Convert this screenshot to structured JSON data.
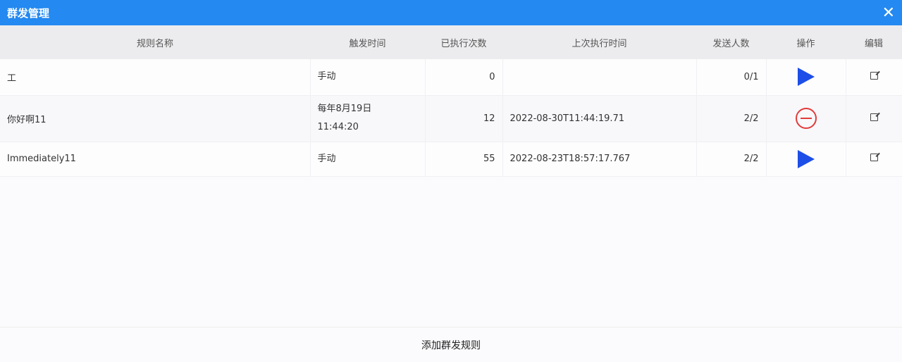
{
  "window": {
    "title": "群发管理"
  },
  "table": {
    "headers": [
      "规则名称",
      "触发时间",
      "已执行次数",
      "上次执行时间",
      "发送人数",
      "操作",
      "编辑"
    ],
    "rows": [
      {
        "name": "工",
        "trigger": "手动",
        "trigger2": "",
        "count": "0",
        "last": "",
        "senders": "0/1",
        "action": "play-icon"
      },
      {
        "name": "你好啊11",
        "trigger": "每年8月19日",
        "trigger2": "11:44:20",
        "count": "12",
        "last": "2022-08-30T11:44:19.71",
        "senders": "2/2",
        "action": "stop-icon"
      },
      {
        "name": "Immediately11",
        "trigger": "手动",
        "trigger2": "",
        "count": "55",
        "last": "2022-08-23T18:57:17.767",
        "senders": "2/2",
        "action": "play-icon"
      }
    ]
  },
  "footer": {
    "add_label": "添加群发规则"
  },
  "colors": {
    "titlebar": "#2489f0",
    "play": "#1d4ee8",
    "stop": "#e23b3b"
  }
}
